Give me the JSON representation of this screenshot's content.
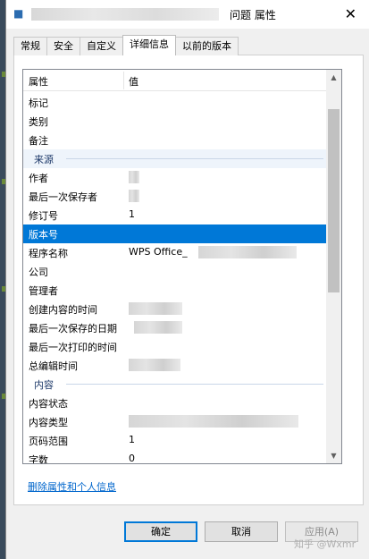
{
  "window": {
    "title": "问题 属性"
  },
  "tabs": [
    {
      "label": "常规",
      "active": false
    },
    {
      "label": "安全",
      "active": false
    },
    {
      "label": "自定义",
      "active": false
    },
    {
      "label": "详细信息",
      "active": true
    },
    {
      "label": "以前的版本",
      "active": false
    }
  ],
  "list": {
    "col_property": "属性",
    "col_value": "值"
  },
  "rows": [
    {
      "k": "标记"
    },
    {
      "k": "类别"
    },
    {
      "k": "备注"
    },
    {
      "k": "来源",
      "group": true
    },
    {
      "k": "作者"
    },
    {
      "k": "最后一次保存者"
    },
    {
      "k": "修订号",
      "v": "1"
    },
    {
      "k": "版本号",
      "selected": true
    },
    {
      "k": "程序名称",
      "v": "WPS Office_"
    },
    {
      "k": "公司"
    },
    {
      "k": "管理者"
    },
    {
      "k": "创建内容的时间"
    },
    {
      "k": "最后一次保存的日期"
    },
    {
      "k": "最后一次打印的时间"
    },
    {
      "k": "总编辑时间"
    },
    {
      "k": "内容",
      "group": true
    },
    {
      "k": "内容状态"
    },
    {
      "k": "内容类型"
    },
    {
      "k": "页码范围",
      "v": "1"
    },
    {
      "k": "字数",
      "v": "0"
    }
  ],
  "link": "删除属性和个人信息",
  "buttons": {
    "ok": "确定",
    "cancel": "取消",
    "apply": "应用(A)"
  },
  "watermark": "知乎 @Wxmr",
  "colors": {
    "selection": "#0078d7",
    "link": "#0066cc"
  }
}
